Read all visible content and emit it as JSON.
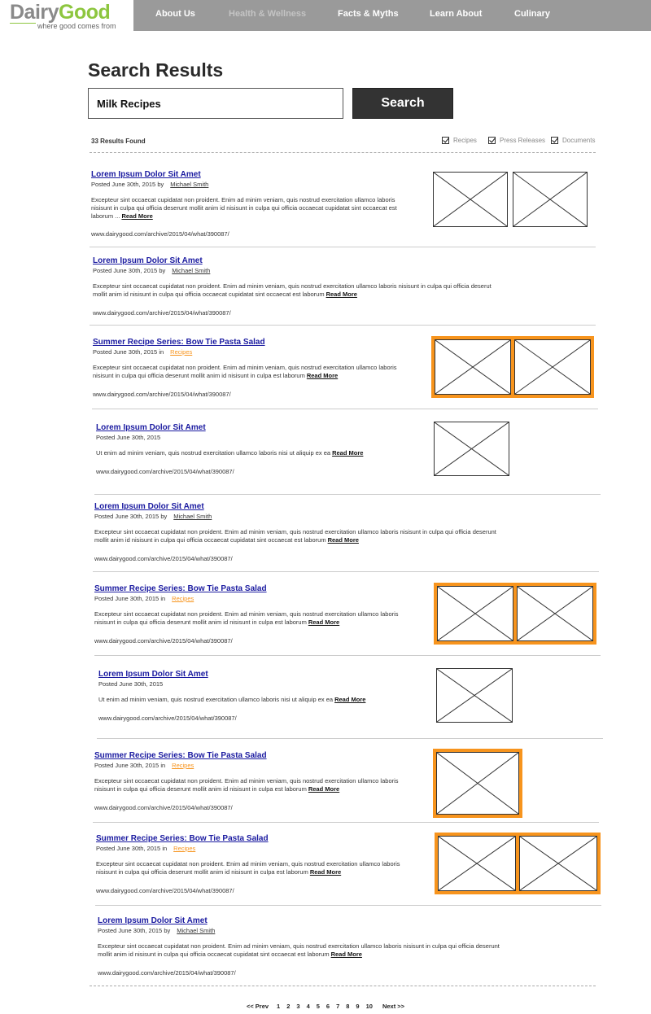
{
  "brand": {
    "word_1": "Dairy",
    "word_2": "Good",
    "tagline": "where good comes from",
    "colors": {
      "gray": "#8a8a8a",
      "green": "#8dc63f",
      "nav": "#9a9a9a",
      "accent": "#f7941d",
      "link": "#1a1aa0"
    }
  },
  "nav": [
    {
      "label": "About Us",
      "active": false
    },
    {
      "label": "Health & Wellness",
      "active": true
    },
    {
      "label": "Facts & Myths",
      "active": false
    },
    {
      "label": "Learn About",
      "active": false
    },
    {
      "label": "Culinary",
      "active": false
    }
  ],
  "page": {
    "title": "Search Results",
    "search_value": "Milk Recipes",
    "search_button": "Search",
    "results_count": "33 Results Found",
    "filters": [
      {
        "label": "Recipes",
        "checked": true
      },
      {
        "label": "Press Releases",
        "checked": true
      },
      {
        "label": "Documents",
        "checked": true
      }
    ]
  },
  "results": [
    {
      "title": "Lorem Ipsum Dolor Sit Amet",
      "posted": "Posted June 30th, 2015 by",
      "author": "Michael Smith",
      "snippet_lines": [
        "Excepteur sint occaecat cupidatat non proident. Enim ad minim veniam,  quis nostrud exercitation ullamco laboris",
        "nisisunt in culpa qui officia  deserunt  mollit anim id nisisunt in culpa qui officia occaecat cupidatat sint occaecat est",
        "laborum ..."
      ],
      "read_more": "Read More",
      "url": "www.dairygood.com/archive/2015/04/what/390087/",
      "images": 2,
      "highlight": false
    },
    {
      "title": "Lorem Ipsum Dolor Sit Amet",
      "posted": "Posted June 30th, 2015 by",
      "author": "Michael Smith",
      "snippet_lines": [
        "Excepteur sint occaecat cupidatat non proident. Enim ad minim veniam,  quis nostrud exercitation ullamco laboris nisisunt in culpa qui officia  deserut",
        "mollit anim id nisisunt in culpa qui officia occaecat cupidatat sint occaecat est laborum"
      ],
      "read_more": "Read More",
      "url": "www.dairygood.com/archive/2015/04/what/390087/",
      "images": 0,
      "highlight": false
    },
    {
      "title": "Summer Recipe Series: Bow Tie Pasta Salad",
      "posted": "Posted June 30th, 2015 in",
      "category": "Recipes",
      "snippet_lines": [
        "Excepteur sint occaecat cupidatat non proident. Enim ad minim veniam,  quis nostrud exercitation ullamco laboris",
        "nisisunt in culpa qui officia  deserunt  mollit anim id nisisunt in culpa est laborum"
      ],
      "read_more": "Read More",
      "url": "www.dairygood.com/archive/2015/04/what/390087/",
      "images": 2,
      "highlight": true
    },
    {
      "title": "Lorem Ipsum Dolor Sit Amet",
      "posted": "Posted June 30th, 2015",
      "snippet_lines": [
        "Ut enim ad minim veniam, quis nostrud exercitation ullamco laboris nisi ut aliquip ex ea"
      ],
      "read_more": "Read More",
      "url": "www.dairygood.com/archive/2015/04/what/390087/",
      "images": 1,
      "highlight": false
    },
    {
      "title": "Lorem Ipsum Dolor Sit Amet",
      "posted": "Posted June 30th, 2015 by",
      "author": "Michael Smith",
      "snippet_lines": [
        "Excepteur sint occaecat cupidatat non proident. Enim ad minim veniam,  quis nostrud exercitation ullamco laboris nisisunt in culpa qui officia  deserunt",
        "mollit anim id nisisunt in culpa qui officia occaecat cupidatat sint occaecat est laborum"
      ],
      "read_more": "Read More",
      "url": "www.dairygood.com/archive/2015/04/what/390087/",
      "images": 0,
      "highlight": false
    },
    {
      "title": "Summer Recipe Series: Bow Tie Pasta Salad",
      "posted": "Posted June 30th, 2015 in",
      "category": "Recipes",
      "snippet_lines": [
        "Excepteur sint occaecat cupidatat non proident. Enim ad minim veniam,  quis nostrud exercitation ullamco laboris",
        "nisisunt in culpa qui officia  deserunt  mollit anim id nisisunt in culpa est laborum"
      ],
      "read_more": "Read More",
      "url": "www.dairygood.com/archive/2015/04/what/390087/",
      "images": 2,
      "highlight": true
    },
    {
      "title": "Lorem Ipsum Dolor Sit Amet",
      "posted": "Posted June 30th, 2015",
      "snippet_lines": [
        "Ut enim ad minim veniam, quis nostrud exercitation ullamco laboris nisi ut aliquip ex ea"
      ],
      "read_more": "Read More",
      "url": "www.dairygood.com/archive/2015/04/what/390087/",
      "images": 1,
      "highlight": false
    },
    {
      "title": "Summer Recipe Series: Bow Tie Pasta Salad",
      "posted": "Posted June 30th, 2015 in",
      "category": "Recipes",
      "snippet_lines": [
        "Excepteur sint occaecat cupidatat non proident. Enim ad minim veniam,  quis nostrud exercitation ullamco laboris",
        "nisisunt in culpa qui officia  deserunt  mollit anim id nisisunt in culpa est laborum"
      ],
      "read_more": "Read More",
      "url": "www.dairygood.com/archive/2015/04/what/390087/",
      "images": 1,
      "highlight": true
    },
    {
      "title": "Summer Recipe Series: Bow Tie Pasta Salad",
      "posted": "Posted June 30th, 2015 in",
      "category": "Recipes",
      "snippet_lines": [
        "Excepteur sint occaecat cupidatat non proident. Enim ad minim veniam,  quis nostrud exercitation ullamco laboris",
        "nisisunt in culpa qui officia  deserunt  mollit anim id nisisunt in culpa est laborum"
      ],
      "read_more": "Read More",
      "url": "www.dairygood.com/archive/2015/04/what/390087/",
      "images": 2,
      "highlight": true
    },
    {
      "title": "Lorem Ipsum Dolor Sit Amet",
      "posted": "Posted June 30th, 2015 by",
      "author": "Michael Smith",
      "snippet_lines": [
        "Excepteur sint occaecat cupidatat non proident. Enim ad minim veniam,  quis nostrud exercitation ullamco laboris nisisunt in culpa qui officia  deserunt",
        "mollit anim id nisisunt in culpa qui officia occaecat cupidatat sint occaecat est laborum"
      ],
      "read_more": "Read More",
      "url": "www.dairygood.com/archive/2015/04/what/390087/",
      "images": 0,
      "highlight": false
    }
  ],
  "pagination": {
    "prev": "<< Prev",
    "pages": [
      "1",
      "2",
      "3",
      "4",
      "5",
      "6",
      "7",
      "8",
      "9",
      "10"
    ],
    "next": "Next >>"
  }
}
